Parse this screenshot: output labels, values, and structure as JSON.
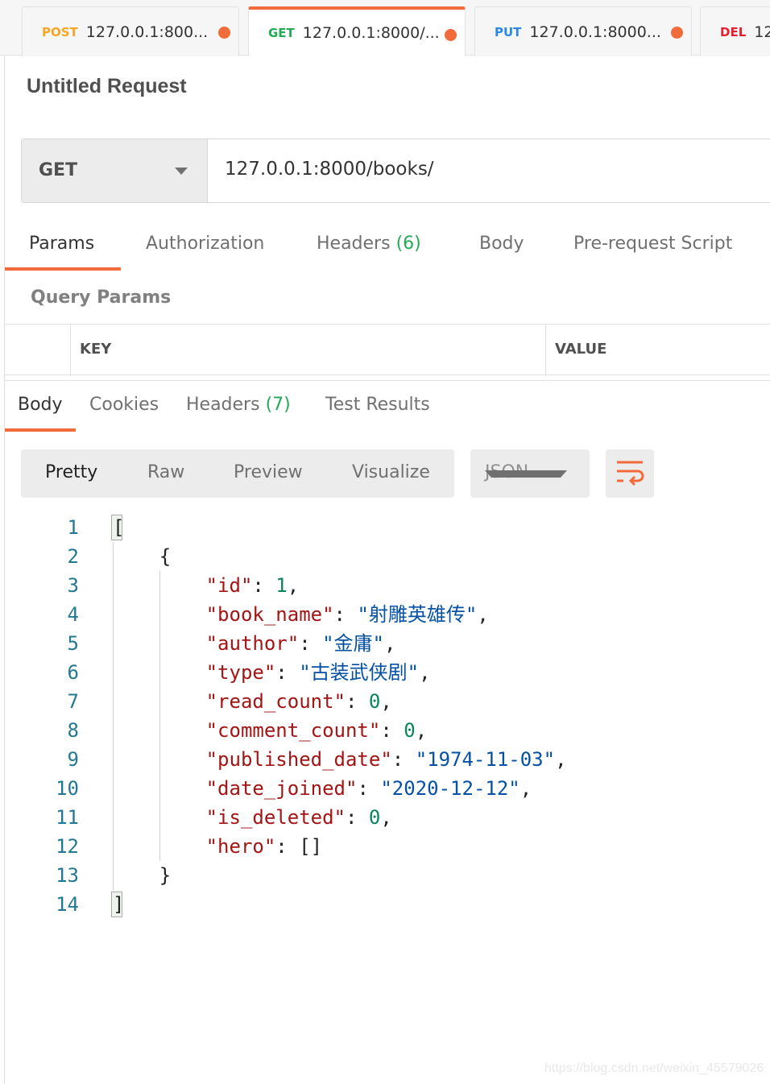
{
  "tabs": [
    {
      "method": "POST",
      "color": "#f5a623",
      "label": "127.0.0.1:800..."
    },
    {
      "method": "GET",
      "color": "#26a957",
      "label": "127.0.0.1:8000/..."
    },
    {
      "method": "PUT",
      "color": "#2a88e6",
      "label": "127.0.0.1:8000..."
    },
    {
      "method": "DEL",
      "color": "#e5202e",
      "label": "12"
    }
  ],
  "request": {
    "title": "Untitled Request",
    "method": "GET",
    "url": "127.0.0.1:8000/books/"
  },
  "request_tabs": [
    {
      "label": "Params"
    },
    {
      "label": "Authorization"
    },
    {
      "label": "Headers",
      "count": "(6)"
    },
    {
      "label": "Body"
    },
    {
      "label": "Pre-request Script"
    }
  ],
  "query_params": {
    "title": "Query Params",
    "key_header": "KEY",
    "value_header": "VALUE"
  },
  "response_tabs": [
    {
      "label": "Body"
    },
    {
      "label": "Cookies"
    },
    {
      "label": "Headers",
      "count": "(7)"
    },
    {
      "label": "Test Results"
    }
  ],
  "view_modes": [
    "Pretty",
    "Raw",
    "Preview",
    "Visualize"
  ],
  "format": "JSON",
  "code_lines": [
    [
      [
        "p",
        "["
      ]
    ],
    [
      [
        "p",
        "    {"
      ]
    ],
    [
      [
        "p",
        "        "
      ],
      [
        "k",
        "\"id\""
      ],
      [
        "p",
        ": "
      ],
      [
        "n",
        "1"
      ],
      [
        "p",
        ","
      ]
    ],
    [
      [
        "p",
        "        "
      ],
      [
        "k",
        "\"book_name\""
      ],
      [
        "p",
        ": "
      ],
      [
        "s",
        "\"射雕英雄传\""
      ],
      [
        "p",
        ","
      ]
    ],
    [
      [
        "p",
        "        "
      ],
      [
        "k",
        "\"author\""
      ],
      [
        "p",
        ": "
      ],
      [
        "s",
        "\"金庸\""
      ],
      [
        "p",
        ","
      ]
    ],
    [
      [
        "p",
        "        "
      ],
      [
        "k",
        "\"type\""
      ],
      [
        "p",
        ": "
      ],
      [
        "s",
        "\"古装武侠剧\""
      ],
      [
        "p",
        ","
      ]
    ],
    [
      [
        "p",
        "        "
      ],
      [
        "k",
        "\"read_count\""
      ],
      [
        "p",
        ": "
      ],
      [
        "n",
        "0"
      ],
      [
        "p",
        ","
      ]
    ],
    [
      [
        "p",
        "        "
      ],
      [
        "k",
        "\"comment_count\""
      ],
      [
        "p",
        ": "
      ],
      [
        "n",
        "0"
      ],
      [
        "p",
        ","
      ]
    ],
    [
      [
        "p",
        "        "
      ],
      [
        "k",
        "\"published_date\""
      ],
      [
        "p",
        ": "
      ],
      [
        "s",
        "\"1974-11-03\""
      ],
      [
        "p",
        ","
      ]
    ],
    [
      [
        "p",
        "        "
      ],
      [
        "k",
        "\"date_joined\""
      ],
      [
        "p",
        ": "
      ],
      [
        "s",
        "\"2020-12-12\""
      ],
      [
        "p",
        ","
      ]
    ],
    [
      [
        "p",
        "        "
      ],
      [
        "k",
        "\"is_deleted\""
      ],
      [
        "p",
        ": "
      ],
      [
        "n",
        "0"
      ],
      [
        "p",
        ","
      ]
    ],
    [
      [
        "p",
        "        "
      ],
      [
        "k",
        "\"hero\""
      ],
      [
        "p",
        ": []"
      ]
    ],
    [
      [
        "p",
        "    }"
      ]
    ],
    [
      [
        "p",
        "]"
      ]
    ]
  ],
  "watermark": "https://blog.csdn.net/weixin_45579026"
}
